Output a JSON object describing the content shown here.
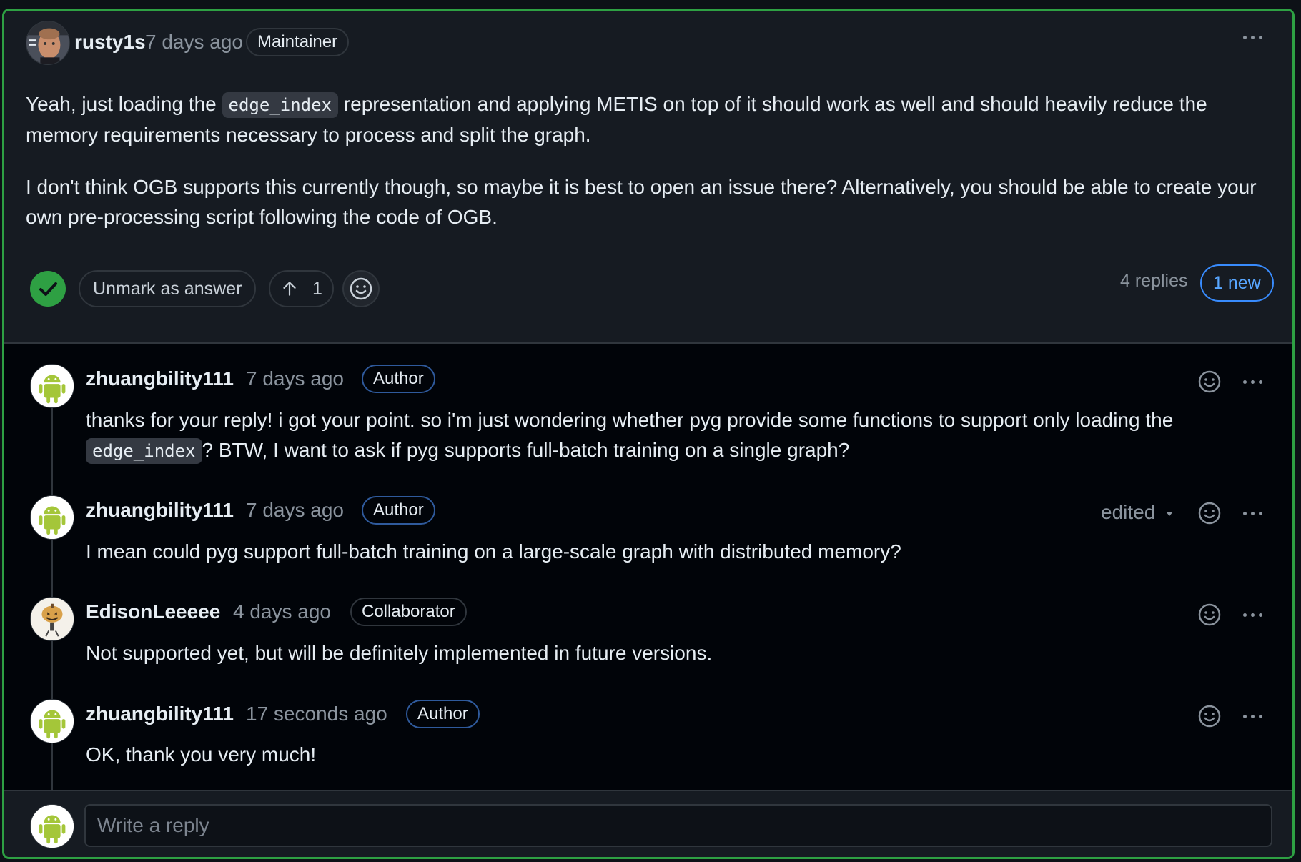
{
  "main_comment": {
    "author": "rusty1s",
    "time": "7 days ago",
    "role": "Maintainer",
    "paragraph1_before": "Yeah, just loading the ",
    "paragraph1_code": "edge_index",
    "paragraph1_after": " representation and applying METIS on top of it should work as well and should heavily reduce the memory requirements necessary to process and split the graph.",
    "paragraph2": "I don't think OGB supports this currently though, so maybe it is best to open an issue there? Alternatively, you should be able to create your own pre-processing script following the code of OGB.",
    "unmark_label": "Unmark as answer",
    "upvote_count": "1",
    "replies_label": "4 replies",
    "new_label": "1 new"
  },
  "replies": [
    {
      "author": "zhuangbility111",
      "time": "7 days ago",
      "role": "Author",
      "text_before": "thanks for your reply! i got your point. so i'm just wondering whether pyg provide some functions to support only loading the ",
      "code": "edge_index",
      "text_after": "? BTW, I want to ask if pyg supports full-batch training on a single graph?"
    },
    {
      "author": "zhuangbility111",
      "time": "7 days ago",
      "role": "Author",
      "edited_label": "edited",
      "text": "I mean could pyg support full-batch training on a large-scale graph with distributed memory?"
    },
    {
      "author": "EdisonLeeeee",
      "time": "4 days ago",
      "role": "Collaborator",
      "text": "Not supported yet, but will be definitely implemented in future versions."
    },
    {
      "author": "zhuangbility111",
      "time": "17 seconds ago",
      "role": "Author",
      "text": "OK, thank you very much!"
    }
  ],
  "reply_box": {
    "placeholder": "Write a reply"
  },
  "colors": {
    "accent_green": "#2ea043",
    "link_blue": "#58a6ff",
    "android_green": "#a4c639"
  },
  "icons": {
    "more": "kebab-horizontal-icon",
    "check": "check-circle-icon",
    "upvote": "arrow-up-icon",
    "reaction": "smiley-icon",
    "caret": "triangle-down-icon"
  }
}
